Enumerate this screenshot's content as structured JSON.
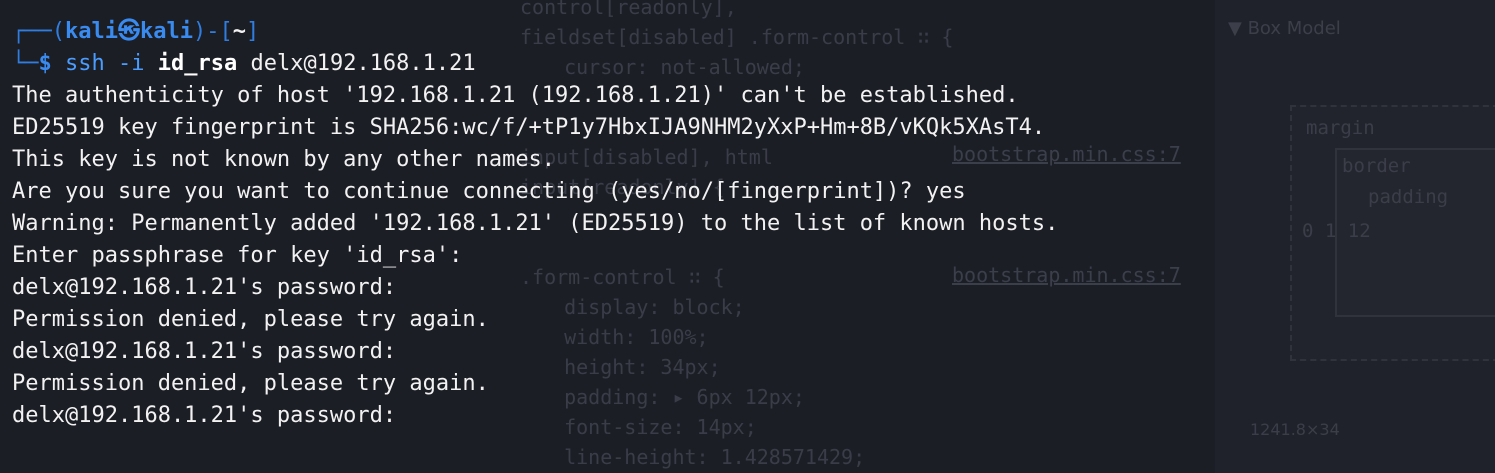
{
  "background": {
    "rules": [
      "control[readonly],",
      "fieldset[disabled] .form-control ∷ {",
      "  cursor: not-allowed;",
      "",
      "",
      "input[disabled], html",
      "input[readonly] {",
      "",
      "",
      ".form-control ∷ {",
      "  display: block;",
      "  width: 100%;",
      "  height: 34px;",
      "  padding: ▸ 6px 12px;",
      "  font-size: 14px;",
      "  line-height: 1.428571429;"
    ],
    "source_link_1": "bootstrap.min.css:7",
    "source_link_2": "bootstrap.min.css:7",
    "box_model_title": "▼ Box Model",
    "box_margin_label": "margin",
    "box_border_label": "border",
    "box_padding_label": "padding",
    "box_values": "0 1 12",
    "element_size": "1241.8×34"
  },
  "terminal": {
    "prompt": {
      "frame_top_left": "┌──(",
      "user": "kali",
      "skull": "㉿",
      "host": "kali",
      "frame_mid": ")-[",
      "path": "~",
      "frame_end": "]",
      "frame_bottom_left": "└─",
      "dollar": "$"
    },
    "command": {
      "name": "ssh",
      "flag": "-i",
      "key_file": "id_rsa",
      "target": "delx@192.168.1.21"
    },
    "output_lines": [
      "The authenticity of host '192.168.1.21 (192.168.1.21)' can't be established.",
      "ED25519 key fingerprint is SHA256:wc/f/+tP1y7HbxIJA9NHM2yXxP+Hm+8B/vKQk5XAsT4.",
      "This key is not known by any other names.",
      "Are you sure you want to continue connecting (yes/no/[fingerprint])? yes",
      "Warning: Permanently added '192.168.1.21' (ED25519) to the list of known hosts.",
      "Enter passphrase for key 'id_rsa':",
      "delx@192.168.1.21's password:",
      "Permission denied, please try again.",
      "delx@192.168.1.21's password:",
      "Permission denied, please try again.",
      "delx@192.168.1.21's password:"
    ]
  }
}
